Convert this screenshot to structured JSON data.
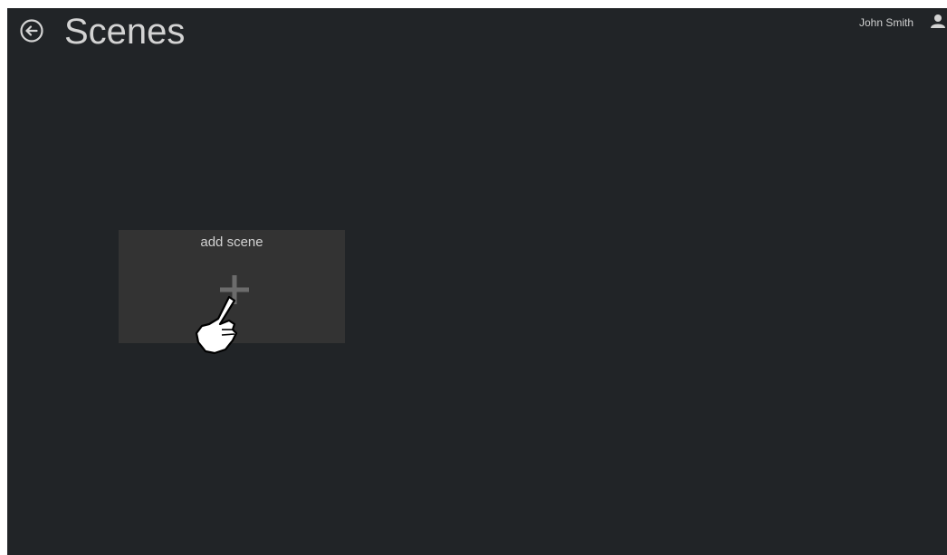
{
  "header": {
    "title": "Scenes",
    "back_icon": "back-arrow-circle-icon",
    "user_name": "John Smith",
    "user_icon": "user-icon"
  },
  "main": {
    "add_tile": {
      "label": "add scene",
      "icon": "plus-icon"
    }
  },
  "cursor": {
    "icon": "hand-pointer-cursor-icon"
  },
  "colors": {
    "background": "#212427",
    "tile": "#333333",
    "text": "#d3d3d3"
  }
}
